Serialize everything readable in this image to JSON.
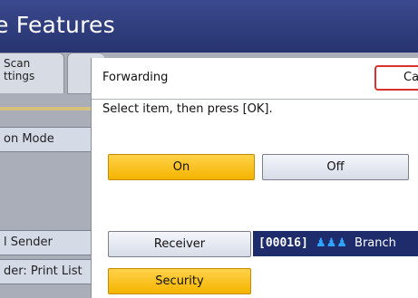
{
  "header": {
    "title": "e Features"
  },
  "left_tabs": {
    "scan_label": "Scan\nttings"
  },
  "left_buttons": [
    {
      "label": "on Mode"
    },
    {
      "label": "l Sender"
    },
    {
      "label": "der: Print List"
    }
  ],
  "dialog": {
    "title": "Forwarding",
    "cancel_label": "Ca",
    "instruction": "Select item, then press [OK].",
    "on_label": "On",
    "off_label": "Off",
    "receiver_label": "Receiver",
    "destination": {
      "code": "[00016]",
      "icon": "people-icon",
      "name": "Branch"
    },
    "security_label": "Security"
  },
  "colors": {
    "header": "#26336f",
    "selected": "#f5b400",
    "cancel_border": "#d8302e",
    "destination_bg": "#1e2c6b"
  }
}
